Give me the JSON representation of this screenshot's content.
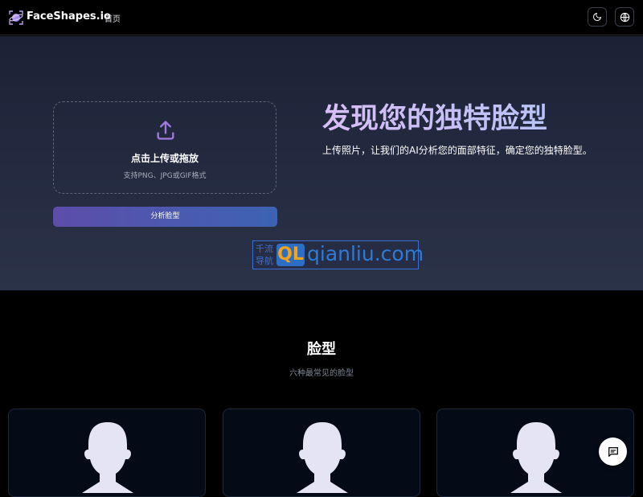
{
  "header": {
    "brand": "FaceShapes.io",
    "nav": {
      "home": "首页"
    },
    "icons": {
      "logo": "planet-logo",
      "theme": "moon-icon",
      "language": "globe-icon"
    }
  },
  "hero": {
    "upload": {
      "icon": "upload-icon",
      "title": "点击上传或拖放",
      "hint": "支持PNG、JPG或GIF格式"
    },
    "analyze_label": "分析脸型",
    "title": "发现您的独特脸型",
    "subtitle": "上传照片，让我们的AI分析您的面部特征，确定您的独特脸型。",
    "watermark": {
      "left_top": "千流",
      "left_bottom": "导航",
      "badge": "QL",
      "domain": "qianliu.com"
    }
  },
  "section": {
    "title": "脸型",
    "subtitle": "六种最常见的脸型",
    "cards": [
      {
        "icon": "face-silhouette-icon"
      },
      {
        "icon": "face-silhouette-icon"
      },
      {
        "icon": "face-silhouette-icon"
      }
    ]
  },
  "chat": {
    "icon": "chat-icon"
  },
  "colors": {
    "background": "#000000",
    "hero_top": "#1c2235",
    "hero_bottom": "#2b3349",
    "accent_start": "#5d4da9",
    "accent_end": "#3d63b3",
    "upload_icon": "#a17ae0",
    "title_gradient_start": "#d9bdf6",
    "title_gradient_end": "#b8c3f7",
    "card_bg": "#040b17",
    "face_fill": "#e4e4f4"
  }
}
